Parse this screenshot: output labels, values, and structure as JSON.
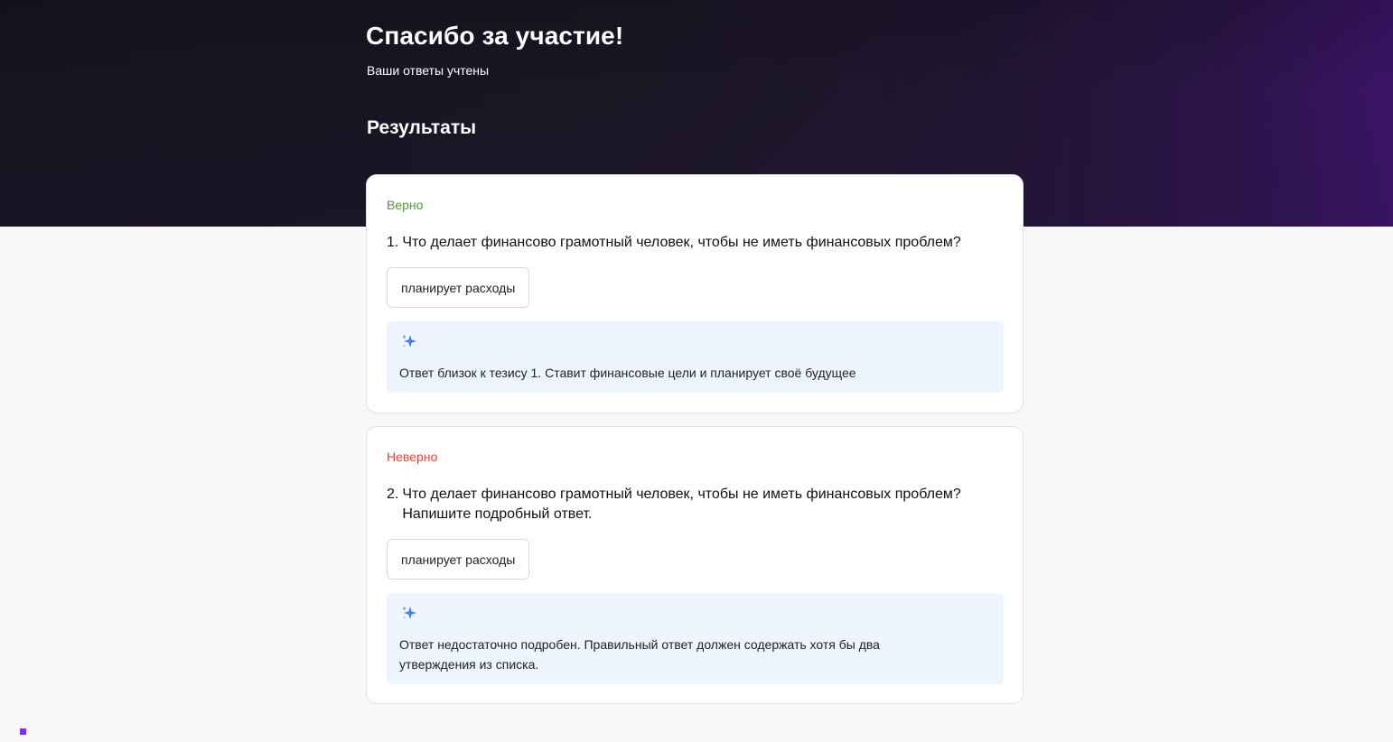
{
  "header": {
    "title": "Спасибо за участие!",
    "subtitle": "Ваши ответы учтены",
    "results_heading": "Результаты"
  },
  "results": [
    {
      "status": "Верно",
      "status_color": "#4f9a3c",
      "number": "1.",
      "question": "Что делает финансово грамотный человек, чтобы не иметь финансовых проблем?",
      "answer": "планирует расходы",
      "ai_icon": "sparkle-icon",
      "feedback": "Ответ близок к тезису 1. Ставит финансовые цели и планирует своё будущее"
    },
    {
      "status": "Неверно",
      "status_color": "#e0483d",
      "number": "2.",
      "question": "Что делает финансово грамотный человек, чтобы не иметь финансовых проблем? Напишите подробный ответ.",
      "answer": "планирует расходы",
      "ai_icon": "sparkle-icon",
      "feedback": "Ответ недостаточно подробен. Правильный ответ должен содержать хотя бы два утверждения из списка."
    }
  ],
  "colors": {
    "accent": "#7b2ff7",
    "feedback_bg": "#eef5fe",
    "sparkle": "#3b82f6"
  }
}
